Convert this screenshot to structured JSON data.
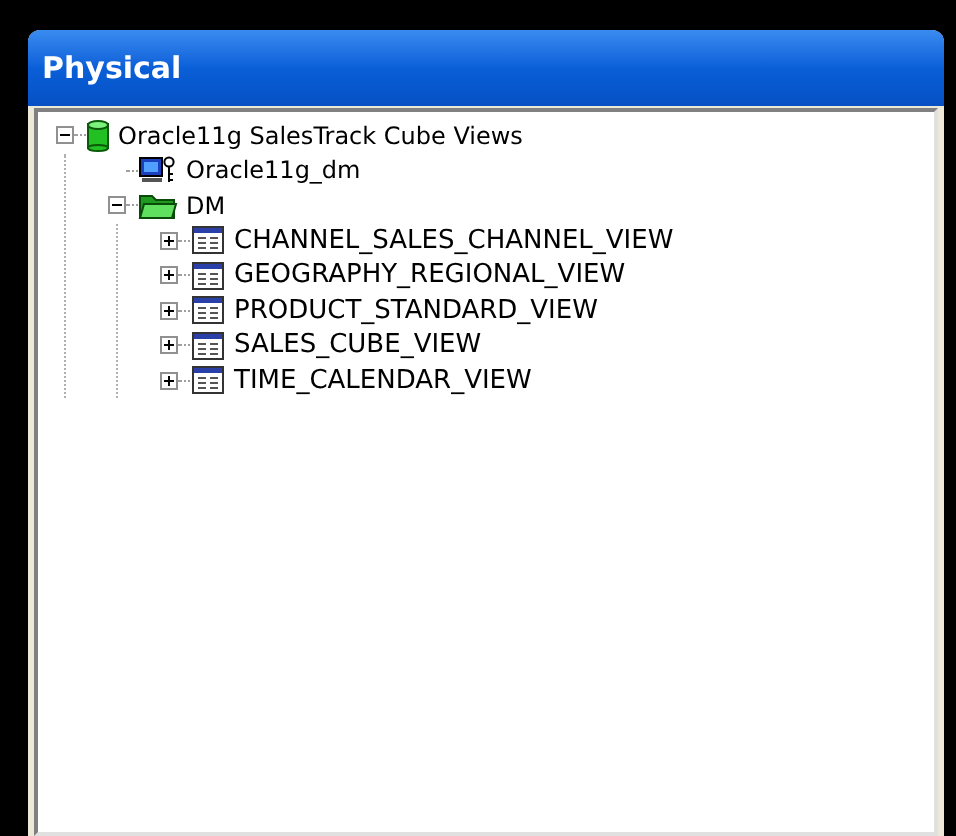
{
  "window": {
    "title": "Physical"
  },
  "tree": [
    {
      "label": "Oracle11g SalesTrack Cube Views",
      "kind": "database",
      "expanded": true,
      "children": [
        {
          "label": "Oracle11g_dm",
          "kind": "connection"
        },
        {
          "label": "DM",
          "kind": "schema",
          "expanded": true,
          "children": [
            {
              "label": "CHANNEL_SALES_CHANNEL_VIEW",
              "kind": "table",
              "expanded": false
            },
            {
              "label": "GEOGRAPHY_REGIONAL_VIEW",
              "kind": "table",
              "expanded": false
            },
            {
              "label": "PRODUCT_STANDARD_VIEW",
              "kind": "table",
              "expanded": false
            },
            {
              "label": "SALES_CUBE_VIEW",
              "kind": "table",
              "expanded": false
            },
            {
              "label": "TIME_CALENDAR_VIEW",
              "kind": "table",
              "expanded": false
            }
          ]
        }
      ]
    }
  ]
}
